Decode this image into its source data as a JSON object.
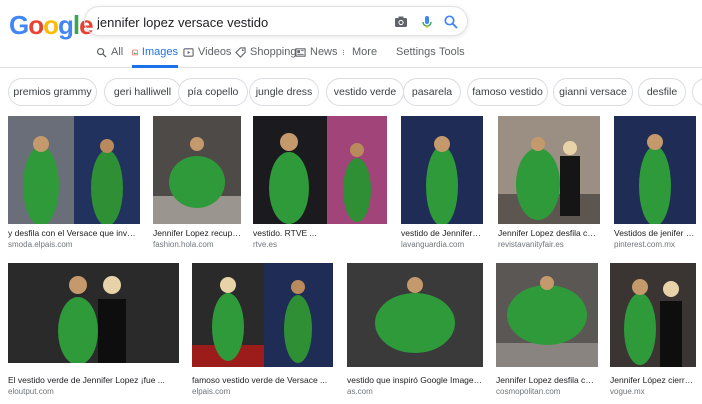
{
  "logo": {
    "letters": [
      "G",
      "o",
      "o",
      "g",
      "l",
      "e"
    ],
    "colors": [
      "#4285F4",
      "#EA4335",
      "#FBBC05",
      "#4285F4",
      "#34A853",
      "#EA4335"
    ]
  },
  "search": {
    "query": "jennifer lopez versace vestido",
    "icons": [
      "camera-icon",
      "microphone-icon",
      "search-icon"
    ]
  },
  "tabs": [
    {
      "label": "All",
      "icon": "search-icon",
      "active": false
    },
    {
      "label": "Images",
      "icon": "images-icon",
      "active": true
    },
    {
      "label": "Videos",
      "icon": "video-icon",
      "active": false
    },
    {
      "label": "Shopping",
      "icon": "tag-icon",
      "active": false
    },
    {
      "label": "News",
      "icon": "news-icon",
      "active": false
    },
    {
      "label": "More",
      "icon": "more-dots-icon",
      "active": false
    },
    {
      "label": "Settings",
      "icon": "",
      "active": false
    },
    {
      "label": "Tools",
      "icon": "",
      "active": false
    }
  ],
  "chips": [
    "premios grammy",
    "geri halliwell",
    "pía copello",
    "jungle dress",
    "vestido verde",
    "pasarela",
    "famoso vestido",
    "gianni versace",
    "desfile"
  ],
  "results": [
    {
      "caption": "y desfila con el Versace que inventó ...",
      "source": "smoda.elpais.com"
    },
    {
      "caption": "Jennifer Lopez recuper...",
      "source": "fashion.hola.com"
    },
    {
      "caption": "vestido. RTVE ...",
      "source": "rtve.es"
    },
    {
      "caption": "vestido de Jennifer Lo...",
      "source": "lavanguardia.com"
    },
    {
      "caption": "Jennifer Lopez desfila con ...",
      "source": "revistavanityfair.es"
    },
    {
      "caption": "Vestidos de jenifer lop...",
      "source": "pinterest.com.mx"
    },
    {
      "caption": "El vestido verde de Jennifer Lopez ¡fue ...",
      "source": "eloutput.com"
    },
    {
      "caption": "famoso vestido verde de Versace ...",
      "source": "elpais.com"
    },
    {
      "caption": "vestido que inspiró Google Images ...",
      "source": "as.com"
    },
    {
      "caption": "Jennifer Lopez desfila con el vestido verde de ...",
      "source": "cosmopolitan.com"
    },
    {
      "caption": "Jennifer López cierra d...",
      "source": "vogue.mx"
    }
  ]
}
